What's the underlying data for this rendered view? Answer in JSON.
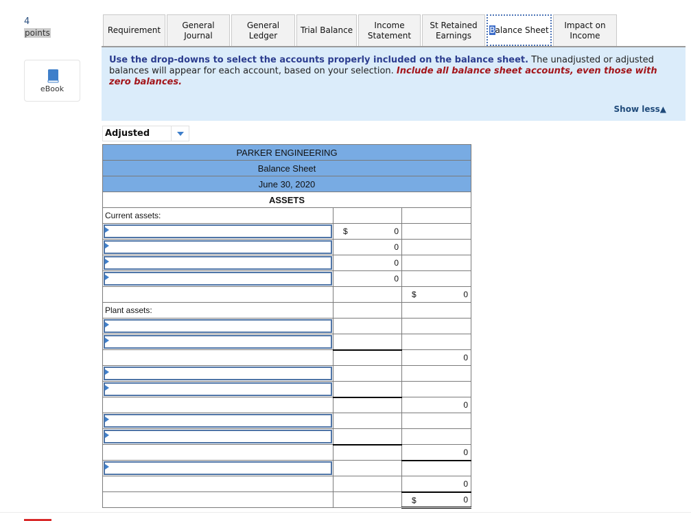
{
  "sidebar": {
    "points_value": "4",
    "points_label": "points",
    "ebook_label": "eBook"
  },
  "tabs": [
    {
      "label_line1": "Requirement",
      "label_line2": "",
      "active": false
    },
    {
      "label_line1": "General",
      "label_line2": "Journal",
      "active": false
    },
    {
      "label_line1": "General",
      "label_line2": "Ledger",
      "active": false
    },
    {
      "label_line1": "Trial Balance",
      "label_line2": "",
      "active": false
    },
    {
      "label_line1": "Income",
      "label_line2": "Statement",
      "active": false
    },
    {
      "label_line1": "St Retained",
      "label_line2": "Earnings",
      "active": false
    },
    {
      "label_line1": "Balance Sheet",
      "label_line2": "",
      "active": true
    },
    {
      "label_line1": "Impact on",
      "label_line2": "Income",
      "active": false
    }
  ],
  "instructions": {
    "bold": "Use the drop-downs to select the accounts properly included on the balance sheet.",
    "normal": " The unadjusted or adjusted balances will appear for each account, based on your selection. ",
    "red": "Include all balance sheet accounts, even those with zero balances.",
    "show_less": "Show less",
    "show_less_icon": "triangle-up"
  },
  "balance_type_select": {
    "value": "Adjusted",
    "icon": "caret-down"
  },
  "balance_sheet": {
    "company": "PARKER ENGINEERING",
    "title": "Balance Sheet",
    "date": "June 30, 2020",
    "section": "ASSETS",
    "current_assets_label": "Current assets:",
    "plant_assets_label": "Plant assets:",
    "currency_symbol": "$",
    "current_asset_amounts": [
      "0",
      "0",
      "0",
      "0"
    ],
    "total_current_assets": "0",
    "plant_subtotal_1": "0",
    "plant_subtotal_2": "0",
    "plant_subtotal_3": "0",
    "total_plant_assets": "0",
    "total_assets": "0"
  }
}
